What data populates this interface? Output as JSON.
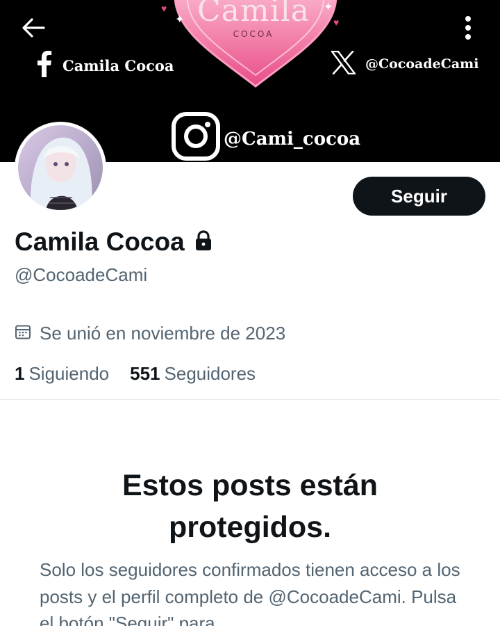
{
  "banner": {
    "brand_title": "Camila",
    "brand_sub": "COCOA",
    "facebook_label": "Camila Cocoa",
    "x_label": "@CocoadeCami",
    "instagram_label": "@Cami_cocoa"
  },
  "header": {
    "back_icon": "arrow-left-icon",
    "more_icon": "more-vertical-icon"
  },
  "profile": {
    "display_name": "Camila Cocoa",
    "lock_icon": "lock-icon",
    "handle": "@CocoadeCami",
    "joined": "Se unió en noviembre de 2023",
    "following_count": "1",
    "following_label": "Siguiendo",
    "followers_count": "551",
    "followers_label": "Seguidores",
    "follow_button": "Seguir"
  },
  "protected": {
    "title": "Estos posts están protegidos.",
    "body": "Solo los seguidores confirmados tienen acceso a los posts y el perfil completo de @CocoadeCami. Pulsa el botón \"Seguir\" para"
  },
  "colors": {
    "accent_dark": "#0f1419",
    "secondary_text": "#536471",
    "banner_bg": "#000000",
    "heart_pink": "#f06a9c"
  }
}
